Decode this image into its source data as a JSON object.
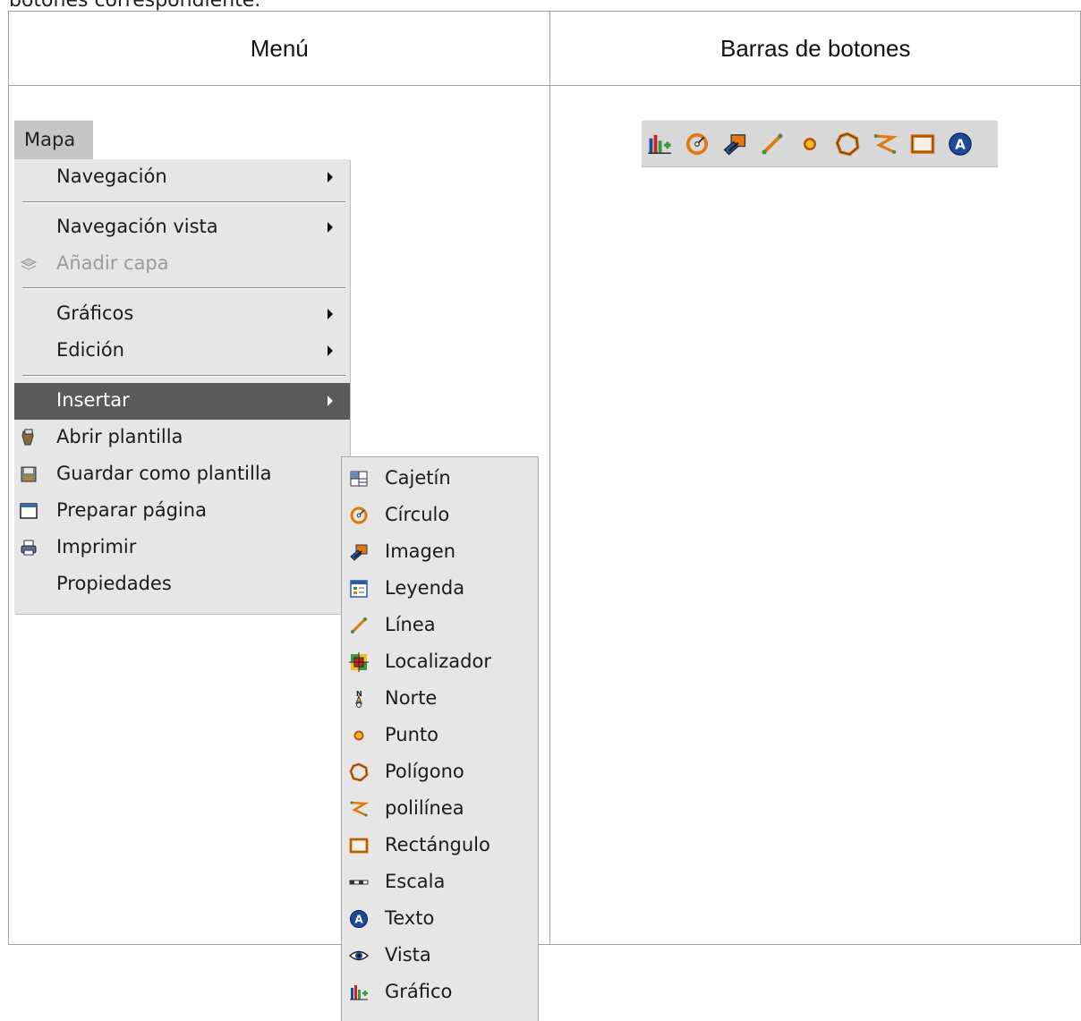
{
  "intro_text": "botones correspondiente.",
  "table": {
    "col1_header": "Menú",
    "col2_header": "Barras de botones"
  },
  "menu": {
    "bar_label": "Mapa",
    "items": [
      {
        "label": "Navegación",
        "submenu": true
      },
      {
        "label": "Navegación vista",
        "submenu": true
      },
      {
        "label": "Añadir capa",
        "disabled": true,
        "icon": "add-layer-icon"
      },
      {
        "label": "Gráficos",
        "submenu": true
      },
      {
        "label": "Edición",
        "submenu": true
      },
      {
        "label": "Insertar",
        "submenu": true,
        "active": true
      },
      {
        "label": "Abrir plantilla",
        "icon": "open-template-icon"
      },
      {
        "label": "Guardar como plantilla",
        "icon": "save-template-icon"
      },
      {
        "label": "Preparar página",
        "icon": "page-setup-icon"
      },
      {
        "label": "Imprimir",
        "icon": "printer-icon"
      },
      {
        "label": "Propiedades"
      }
    ]
  },
  "submenu": {
    "items": [
      {
        "label": "Cajetín",
        "icon": "cajetin-icon"
      },
      {
        "label": "Círculo",
        "icon": "circle-icon"
      },
      {
        "label": "Imagen",
        "icon": "image-icon"
      },
      {
        "label": "Leyenda",
        "icon": "legend-icon"
      },
      {
        "label": "Línea",
        "icon": "line-icon"
      },
      {
        "label": "Localizador",
        "icon": "locator-icon"
      },
      {
        "label": "Norte",
        "icon": "north-icon"
      },
      {
        "label": "Punto",
        "icon": "point-icon"
      },
      {
        "label": "Polígono",
        "icon": "polygon-icon"
      },
      {
        "label": "polilínea",
        "icon": "polyline-icon"
      },
      {
        "label": "Rectángulo",
        "icon": "rectangle-icon"
      },
      {
        "label": "Escala",
        "icon": "scale-icon"
      },
      {
        "label": "Texto",
        "icon": "text-icon"
      },
      {
        "label": "Vista",
        "icon": "view-icon"
      },
      {
        "label": "Gráfico",
        "icon": "chart-icon"
      }
    ]
  },
  "toolbar": {
    "buttons": [
      "chart-icon",
      "circle-icon",
      "image-icon",
      "line-icon",
      "point-icon",
      "polygon-icon",
      "polyline-icon",
      "rectangle-icon",
      "text-icon"
    ]
  },
  "colors": {
    "active_bg": "#5a5a5a",
    "menu_bg": "#e6e6e6",
    "accent_orange": "#e07a10"
  }
}
